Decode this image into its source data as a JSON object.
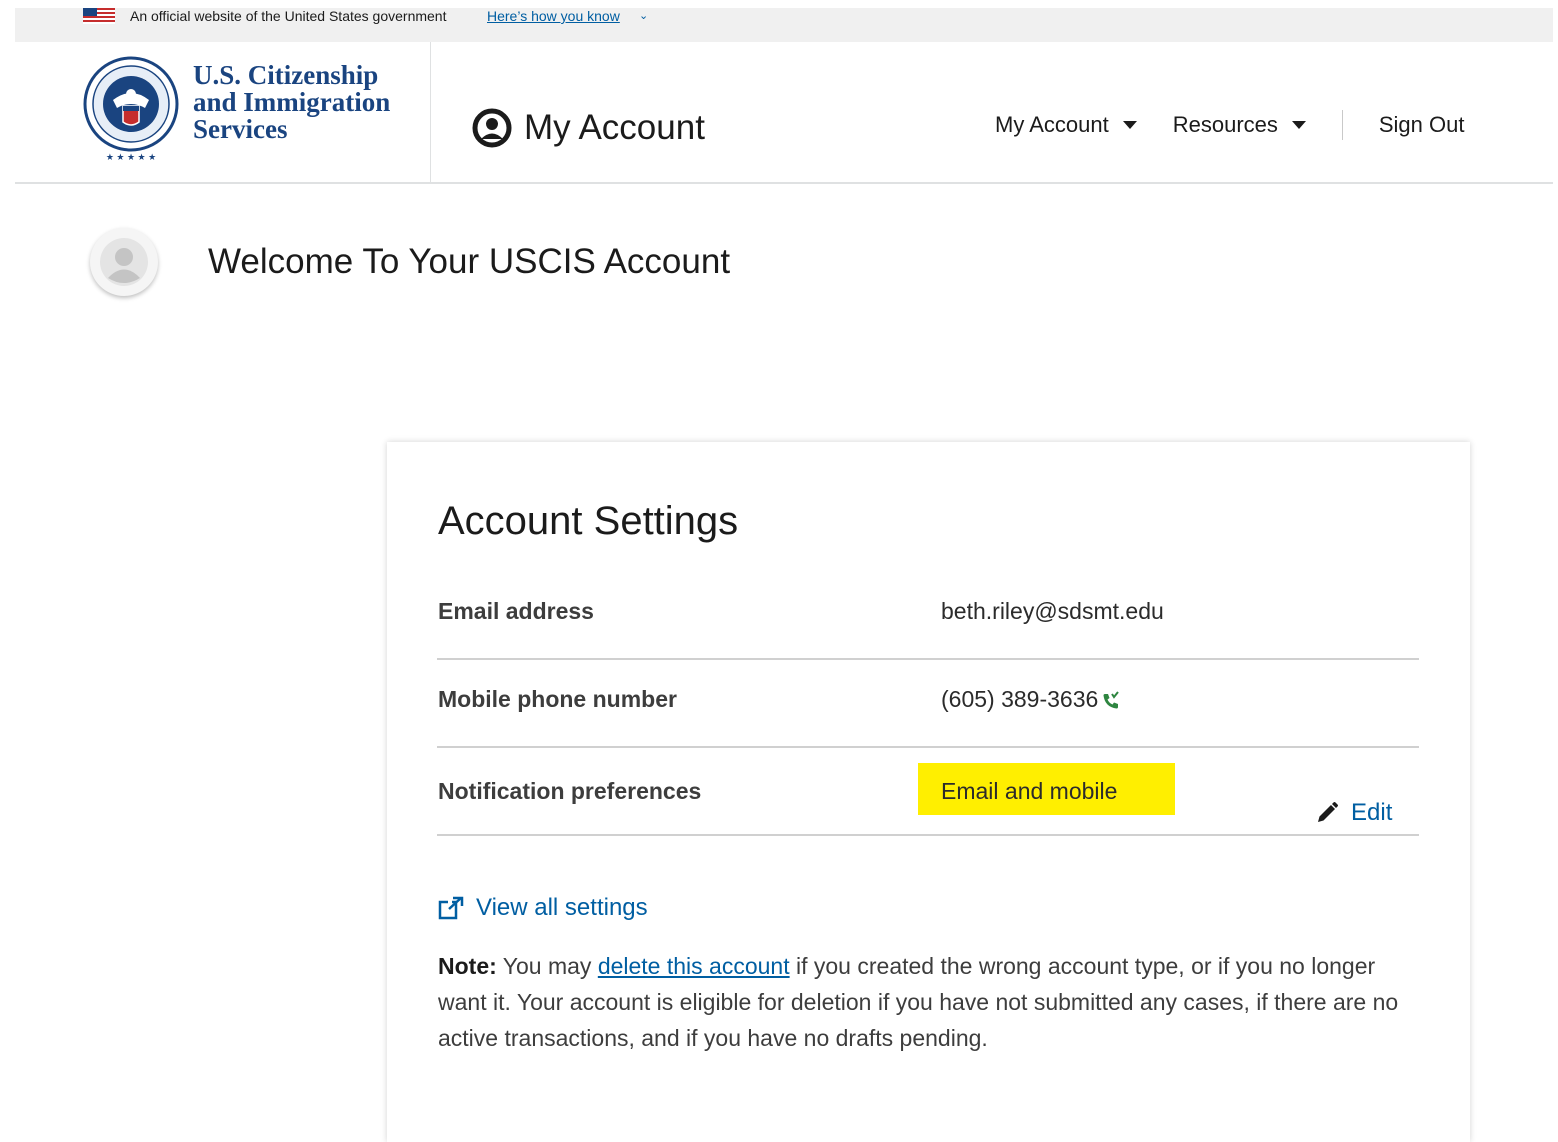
{
  "gov_banner": {
    "text": "An official website of the United States government",
    "link": "Here’s how you know",
    "chevron_icon": "chevron-down-icon"
  },
  "header": {
    "agency_line1": "U.S. Citizenship",
    "agency_line2": "and Immigration",
    "agency_line3": "Services",
    "app_title": "My Account",
    "nav": {
      "my_account": "My Account",
      "resources": "Resources",
      "sign_out": "Sign Out"
    }
  },
  "welcome": {
    "title": "Welcome To Your USCIS Account"
  },
  "settings": {
    "title": "Account Settings",
    "email_label": "Email address",
    "email_value": "beth.riley@sdsmt.edu",
    "phone_label": "Mobile phone number",
    "phone_value": "(605) 389-3636",
    "notif_label": "Notification preferences",
    "notif_value": "Email and mobile",
    "edit_label": "Edit",
    "view_all": "View all settings",
    "note_label": "Note:",
    "note_pre": " You may ",
    "note_link": "delete this account",
    "note_post": " if you created the wrong account type, or if you no longer want it. Your account is eligible for deletion if you have not submitted any cases, if there are no active transactions, and if you have no drafts pending."
  },
  "colors": {
    "brand_blue": "#1a4480",
    "link_blue": "#005ea2",
    "highlight": "#ffef00",
    "phone_green": "#2e8540"
  }
}
